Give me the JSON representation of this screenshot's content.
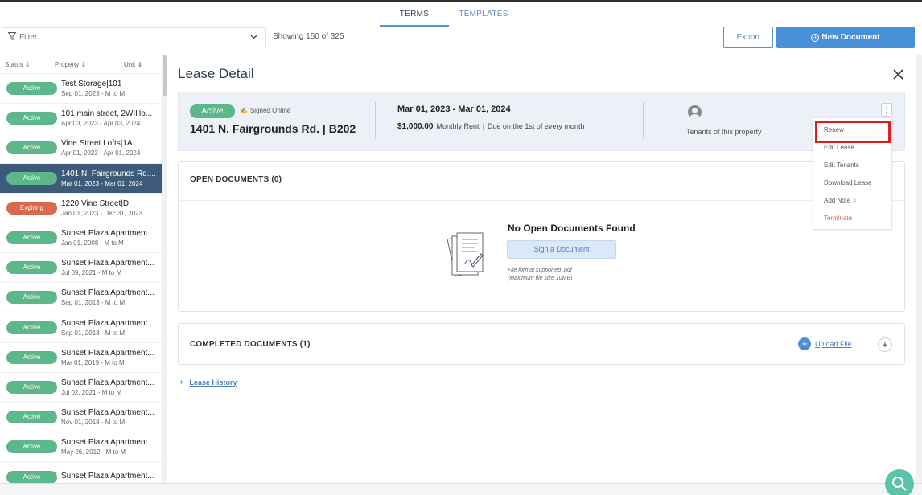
{
  "tabs": [
    {
      "label": "TERMS"
    },
    {
      "label": "TEMPLATES"
    }
  ],
  "filter": {
    "placeholder": "Filter...",
    "showing": "Showing 150 of 325"
  },
  "actions": {
    "export": "Export",
    "new_document": "New Document"
  },
  "sidebar": {
    "columns": {
      "status": "Status",
      "property": "Property",
      "unit": "Unit"
    },
    "rows": [
      {
        "status": "Active",
        "title": "Test Storage|101",
        "sub": "Sep 01, 2023 - M to M"
      },
      {
        "status": "Active",
        "title": "101 main street, 2W|Ho...",
        "sub": "Apr 03, 2023 - Apr 03, 2024"
      },
      {
        "status": "Active",
        "title": "Vine Street Lofts|1A",
        "sub": "Apr 01, 2023 - Apr 01, 2024"
      },
      {
        "status": "Active",
        "title": "1401 N. Fairgrounds Rd....",
        "sub": "Mar 01, 2023 - Mar 01, 2024"
      },
      {
        "status": "Expiring",
        "title": "1220 Vine Street|D",
        "sub": "Jan 01, 2023 - Dec 31, 2023"
      },
      {
        "status": "Active",
        "title": "Sunset Plaza Apartment...",
        "sub": "Jan 01, 2008 - M to M"
      },
      {
        "status": "Active",
        "title": "Sunset Plaza Apartment...",
        "sub": "Jul 09, 2021 - M to M"
      },
      {
        "status": "Active",
        "title": "Sunset Plaza Apartment...",
        "sub": "Sep 01, 2013 - M to M"
      },
      {
        "status": "Active",
        "title": "Sunset Plaza Apartment...",
        "sub": "Sep 01, 2013 - M to M"
      },
      {
        "status": "Active",
        "title": "Sunset Plaza Apartment...",
        "sub": "Mar 01, 2019 - M to M"
      },
      {
        "status": "Active",
        "title": "Sunset Plaza Apartment...",
        "sub": "Jul 02, 2021 - M to M"
      },
      {
        "status": "Active",
        "title": "Sunset Plaza Apartment...",
        "sub": "Nov 01, 2018 - M to M"
      },
      {
        "status": "Active",
        "title": "Sunset Plaza Apartment...",
        "sub": "May 26, 2012 - M to M"
      },
      {
        "status": "Active",
        "title": "Sunset Plaza Apartment...",
        "sub": ""
      }
    ]
  },
  "detail": {
    "title": "Lease Detail",
    "status": "Active",
    "signed": "Signed Online",
    "property": "1401 N. Fairgrounds Rd. | B202",
    "dates": "Mar 01, 2023 - Mar 01, 2024",
    "rent_amount": "$1,000.00",
    "rent_label": "Monthly Rent",
    "due": "Due on the 1st of every month",
    "tenants_label": "Tenants of this property"
  },
  "menu": {
    "renew": "Renew",
    "edit_lease": "Edit Lease",
    "edit_tenants": "Edit Tenants",
    "download_lease": "Download Lease",
    "add_note": "Add Note",
    "note_count": "0",
    "terminate": "Terminate"
  },
  "open_docs": {
    "title": "OPEN DOCUMENTS (0)",
    "empty_title": "No Open Documents Found",
    "sign_button": "Sign a Document",
    "format_note": "File format supported .pdf",
    "size_note": "(Maximum file size 10MB)"
  },
  "completed_docs": {
    "title": "COMPLETED DOCUMENTS (1)",
    "upload": "Upload File"
  },
  "history": {
    "label": "Lease History"
  },
  "colors": {
    "accent": "#4a90d9",
    "active": "#5cb88a",
    "expiring": "#d9684e",
    "selected_row": "#3d5a7a",
    "highlight": "#e21b1b"
  }
}
